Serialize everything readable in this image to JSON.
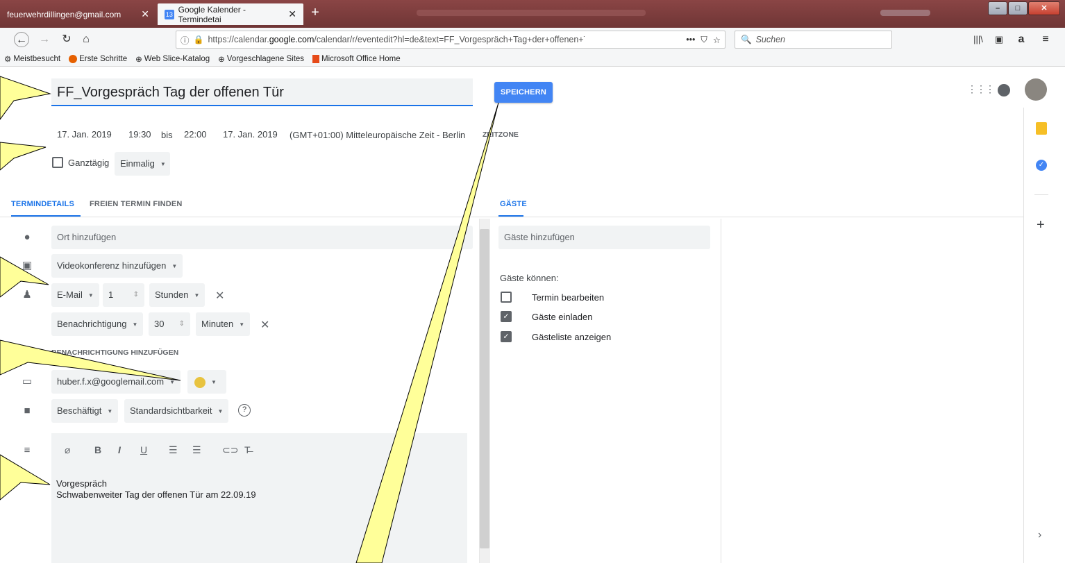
{
  "browser": {
    "tabs": [
      {
        "label": "feuerwehrdillingen@gmail.com",
        "close": "✕"
      },
      {
        "favicon": "13",
        "label": "Google Kalender - Termindetai",
        "close": "✕"
      }
    ],
    "new_tab": "+",
    "window_controls": [
      "–",
      "□",
      "✕"
    ],
    "url_prefix": "https://calendar.",
    "url_host": "google.com",
    "url_rest": "/calendar/r/eventedit?hl=de&text=FF_Vorgespräch+Tag+der+offenen+Tür&dates",
    "url_more": "•••",
    "search_placeholder": "Suchen",
    "amazon_icon": "a",
    "bookmarks": [
      "Meistbesucht",
      "Erste Schritte",
      "Web Slice-Katalog",
      "Vorgeschlagene Sites",
      "Microsoft Office Home"
    ]
  },
  "editor": {
    "title": "FF_Vorgespräch Tag der offenen Tür",
    "save_label": "SPEICHERN",
    "start_date": "17. Jan. 2019",
    "start_time": "19:30",
    "until": "bis",
    "end_time": "22:00",
    "end_date": "17. Jan. 2019",
    "timezone": "(GMT+01:00) Mitteleuropäische Zeit - Berlin",
    "timezone_button": "ZEITZONE",
    "allday_label": "Ganztägig",
    "repeat_label": "Einmalig",
    "tabs": {
      "details": "TERMINDETAILS",
      "find_time": "FREIEN TERMIN FINDEN",
      "guests": "GÄSTE"
    },
    "location_placeholder": "Ort hinzufügen",
    "video_label": "Videokonferenz hinzufügen",
    "notifications": [
      {
        "type": "E-Mail",
        "value": "1",
        "unit": "Stunden"
      },
      {
        "type": "Benachrichtigung",
        "value": "30",
        "unit": "Minuten"
      }
    ],
    "add_notification": "BENACHRICHTIGUNG HINZUFÜGEN",
    "calendar": "huber.f.x@googlemail.com",
    "event_color": "#e8c33f",
    "busy": "Beschäftigt",
    "visibility": "Standardsichtbarkeit",
    "description_line1": "Vorgespräch",
    "description_line2": "Schwabenweiter Tag der offenen Tür am 22.09.19"
  },
  "guests": {
    "placeholder": "Gäste hinzufügen",
    "can_label": "Gäste können:",
    "permissions": [
      {
        "label": "Termin bearbeiten",
        "checked": false
      },
      {
        "label": "Gäste einladen",
        "checked": true
      },
      {
        "label": "Gästeliste anzeigen",
        "checked": true
      }
    ]
  },
  "colors": {
    "accent": "#1a73e8",
    "save_button": "#4285f4",
    "callout_fill": "#ffff99"
  }
}
